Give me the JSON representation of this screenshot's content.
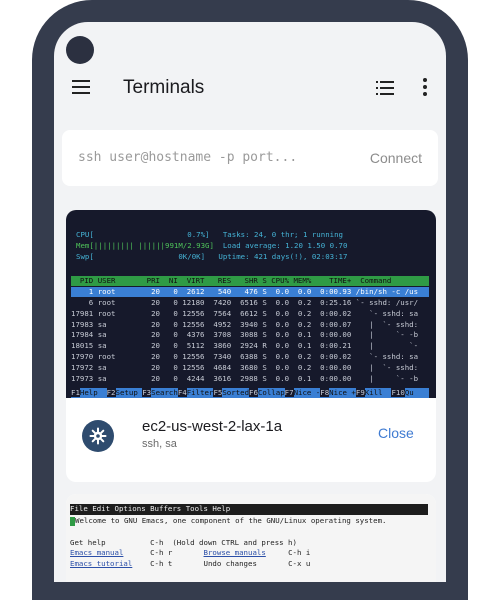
{
  "app": {
    "title": "Terminals"
  },
  "ssh": {
    "placeholder": "ssh user@hostname -p port...",
    "connect_label": "Connect"
  },
  "session": {
    "host": "ec2-us-west-2-lax-1a",
    "subtitle": "ssh, sa",
    "close_label": "Close"
  },
  "htop": {
    "cpu_line": "CPU[                     0.7%]",
    "tasks_line": "Tasks: 24, 0 thr; 1 running",
    "mem_line": "Mem[||||||||| ||||||991M/2.93G]",
    "load_line": "Load average: 1.20 1.50 0.70",
    "swp_line": "Swp[                   0K/0K]",
    "uptime_line": "Uptime: 421 days(!), 02:03:17",
    "header": "  PID USER       PRI  NI  VIRT   RES   SHR S CPU% MEM%    TIME+  Command",
    "selected_row": "    1 root        20   0  2612   540   476 S  0.0  0.0  0:00.93 /bin/sh -c /us",
    "processes": [
      "    6 root        20   0 12180  7420  6516 S  0.0  0.2  0:25.16 `- sshd: /usr/",
      "17981 root        20   0 12556  7564  6612 S  0.0  0.2  0:00.02    `- sshd: sa",
      "17983 sa          20   0 12556  4952  3940 S  0.0  0.2  0:00.07    |  `- sshd:",
      "17984 sa          20   0  4376  3708  3088 S  0.0  0.1  0:00.00    |     `- -b",
      "18015 sa          20   0  5112  3860  2924 R  0.0  0.1  0:00.21    |        `-",
      "17970 root        20   0 12556  7340  6388 S  0.0  0.2  0:00.02    `- sshd: sa",
      "17972 sa          20   0 12556  4684  3680 S  0.0  0.2  0:00.00    |  `- sshd:",
      "17973 sa          20   0  4244  3616  2988 S  0.0  0.1  0:00.00    |     `- -b"
    ],
    "function_keys": [
      {
        "key": "F1",
        "label": "Help  "
      },
      {
        "key": "F2",
        "label": "Setup "
      },
      {
        "key": "F3",
        "label": "Search"
      },
      {
        "key": "F4",
        "label": "Filter"
      },
      {
        "key": "F5",
        "label": "Sorted"
      },
      {
        "key": "F6",
        "label": "Collap"
      },
      {
        "key": "F7",
        "label": "Nice -"
      },
      {
        "key": "F8",
        "label": "Nice +"
      },
      {
        "key": "F9",
        "label": "Kill  "
      },
      {
        "key": "F10",
        "label": "Qu"
      }
    ]
  },
  "emacs": {
    "menu": "File Edit Options Buffers Tools Help",
    "welcome": "Welcome to GNU Emacs, one component of the GNU/Linux operating system.",
    "get_help": "Get help",
    "get_help_key": "C-h  (Hold down CTRL and press h)",
    "manual_link": "Emacs manual",
    "manual_key": "C-h r",
    "browse_link": "Browse manuals",
    "browse_key": "C-h i",
    "tutorial_link": "Emacs tutorial",
    "tutorial_key": "C-h t",
    "undo": "Undo changes",
    "undo_key": "C-x u"
  },
  "colors": {
    "accent": "#3f7bd2",
    "phone_frame": "#353c4d",
    "terminal_bg": "#16192b",
    "htop_header": "#2f9b45"
  }
}
